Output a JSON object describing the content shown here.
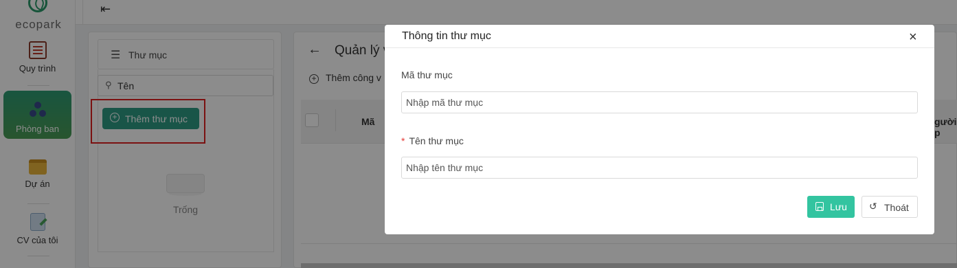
{
  "brand": {
    "logo_text": "ecopark"
  },
  "sidebar": {
    "items": [
      {
        "label": "Quy trình",
        "icon": "process-icon"
      },
      {
        "label": "Phòng ban",
        "icon": "department-icon",
        "active": true
      },
      {
        "label": "Dự án",
        "icon": "folder-icon"
      },
      {
        "label": "CV của tôi",
        "icon": "my-task-icon"
      }
    ]
  },
  "topbar": {
    "menu_icon": "menu-fold-icon"
  },
  "folder_panel": {
    "header": "Thư mục",
    "search_text": "Tên",
    "add_button": "Thêm thư mục",
    "empty_text": "Trống"
  },
  "main_panel": {
    "breadcrumb": "Quản lý v",
    "add_job": "Thêm công v",
    "columns": {
      "code": "Mã",
      "assignee": "gười p"
    }
  },
  "modal": {
    "title": "Thông tin thư mục",
    "code_label": "Mã thư mục",
    "code_placeholder": "Nhập mã thư mục",
    "name_required_mark": "*",
    "name_label": "Tên thư mục",
    "name_placeholder": "Nhập tên thư mục",
    "save_button": "Lưu",
    "exit_button": "Thoát",
    "close_glyph": "×"
  },
  "colors": {
    "brand_green": "#2e9b84",
    "save_green": "#33c4a0",
    "highlight_red": "#e02020"
  }
}
